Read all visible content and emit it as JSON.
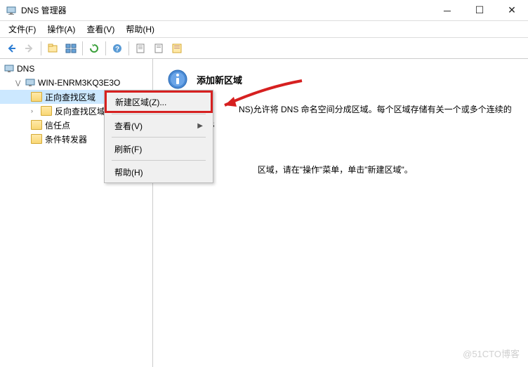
{
  "window": {
    "title": "DNS 管理器"
  },
  "menubar": {
    "file": "文件(F)",
    "action": "操作(A)",
    "view": "查看(V)",
    "help": "帮助(H)"
  },
  "tree": {
    "root": "DNS",
    "server": "WIN-ENRM3KQ3E3O",
    "forward": "正向查找区域",
    "reverse": "反向查找区域",
    "trust": "信任点",
    "conditional": "条件转发器"
  },
  "content": {
    "heading": "添加新区域",
    "body_line1": "                  NS)允许将 DNS 命名空间分成区域。每个区域存储有关一个或多个连续的 DNS",
    "body_line2": "                          区域，请在\"操作\"菜单，单击\"新建区域\"。"
  },
  "context_menu": {
    "new_zone": "新建区域(Z)...",
    "view": "查看(V)",
    "refresh": "刷新(F)",
    "help": "帮助(H)"
  },
  "watermark": "@51CTO博客"
}
